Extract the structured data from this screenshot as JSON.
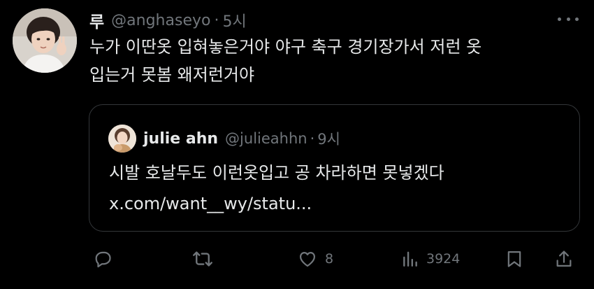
{
  "tweet": {
    "display_name": "루",
    "handle": "@anghaseyo",
    "separator": "·",
    "time": "5시",
    "text_line1": "누가 이딴옷 입혀놓은거야 야구 축구 경기장가서 저런 옷",
    "text_line2": "입는거 못봄 왜저런거야"
  },
  "quote": {
    "display_name": "julie ahn",
    "handle": "@julieahhn",
    "separator": "·",
    "time": "9시",
    "text_line1": "시발 호날두도 이런옷입고 공 차라하면 못넣겠다",
    "link": "x.com/want__wy/statu..."
  },
  "actions": {
    "reply_icon": "reply-icon",
    "repost_icon": "repost-icon",
    "like_icon": "heart-icon",
    "like_count": "8",
    "views_icon": "views-icon",
    "views_count": "3924",
    "bookmark_icon": "bookmark-icon",
    "share_icon": "share-icon"
  },
  "colors": {
    "background": "#000000",
    "text": "#e7e9ea",
    "secondary": "#71767b",
    "border": "#333639"
  }
}
